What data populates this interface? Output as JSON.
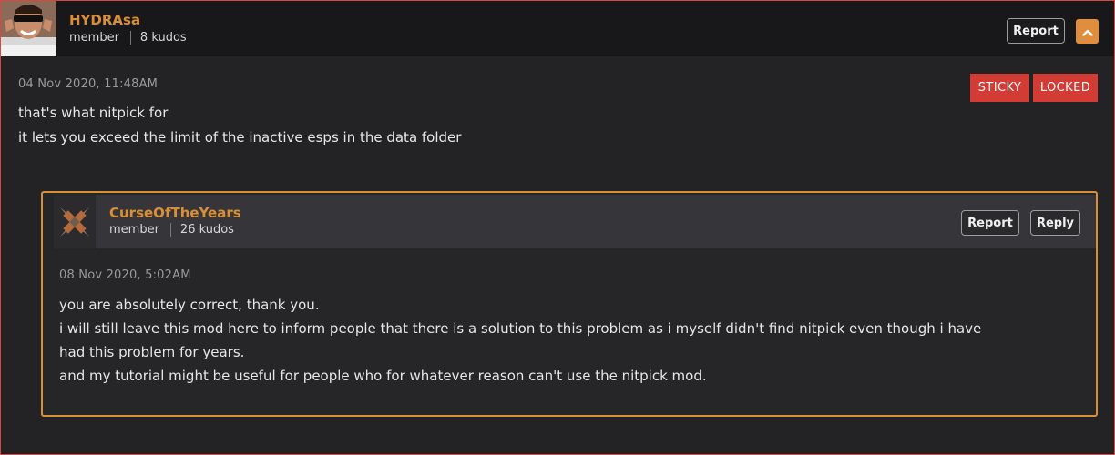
{
  "post": {
    "username": "HYDRAsa",
    "role": "member",
    "kudos": "8 kudos",
    "report_label": "Report",
    "date": "04 Nov 2020, 11:48AM",
    "tags": [
      "STICKY",
      "LOCKED"
    ],
    "lines": [
      "that's what nitpick for",
      "it lets you exceed the limit of the inactive esps in the data folder"
    ]
  },
  "reply": {
    "username": "CurseOfTheYears",
    "role": "member",
    "kudos": "26 kudos",
    "report_label": "Report",
    "reply_label": "Reply",
    "date": "08 Nov 2020, 5:02AM",
    "lines": [
      "you are absolutely correct, thank you.",
      "i will still leave this mod here to inform people that there is a solution to this problem as i myself didn't find nitpick even though i have",
      "had this problem for years.",
      "and my tutorial might be useful for people who for whatever reason can't use the nitpick mod."
    ]
  },
  "colors": {
    "accent": "#d98f37",
    "tag": "#d23c34",
    "border": "#d44a3c"
  },
  "icons": {
    "collapse": "chevron-up-icon"
  }
}
